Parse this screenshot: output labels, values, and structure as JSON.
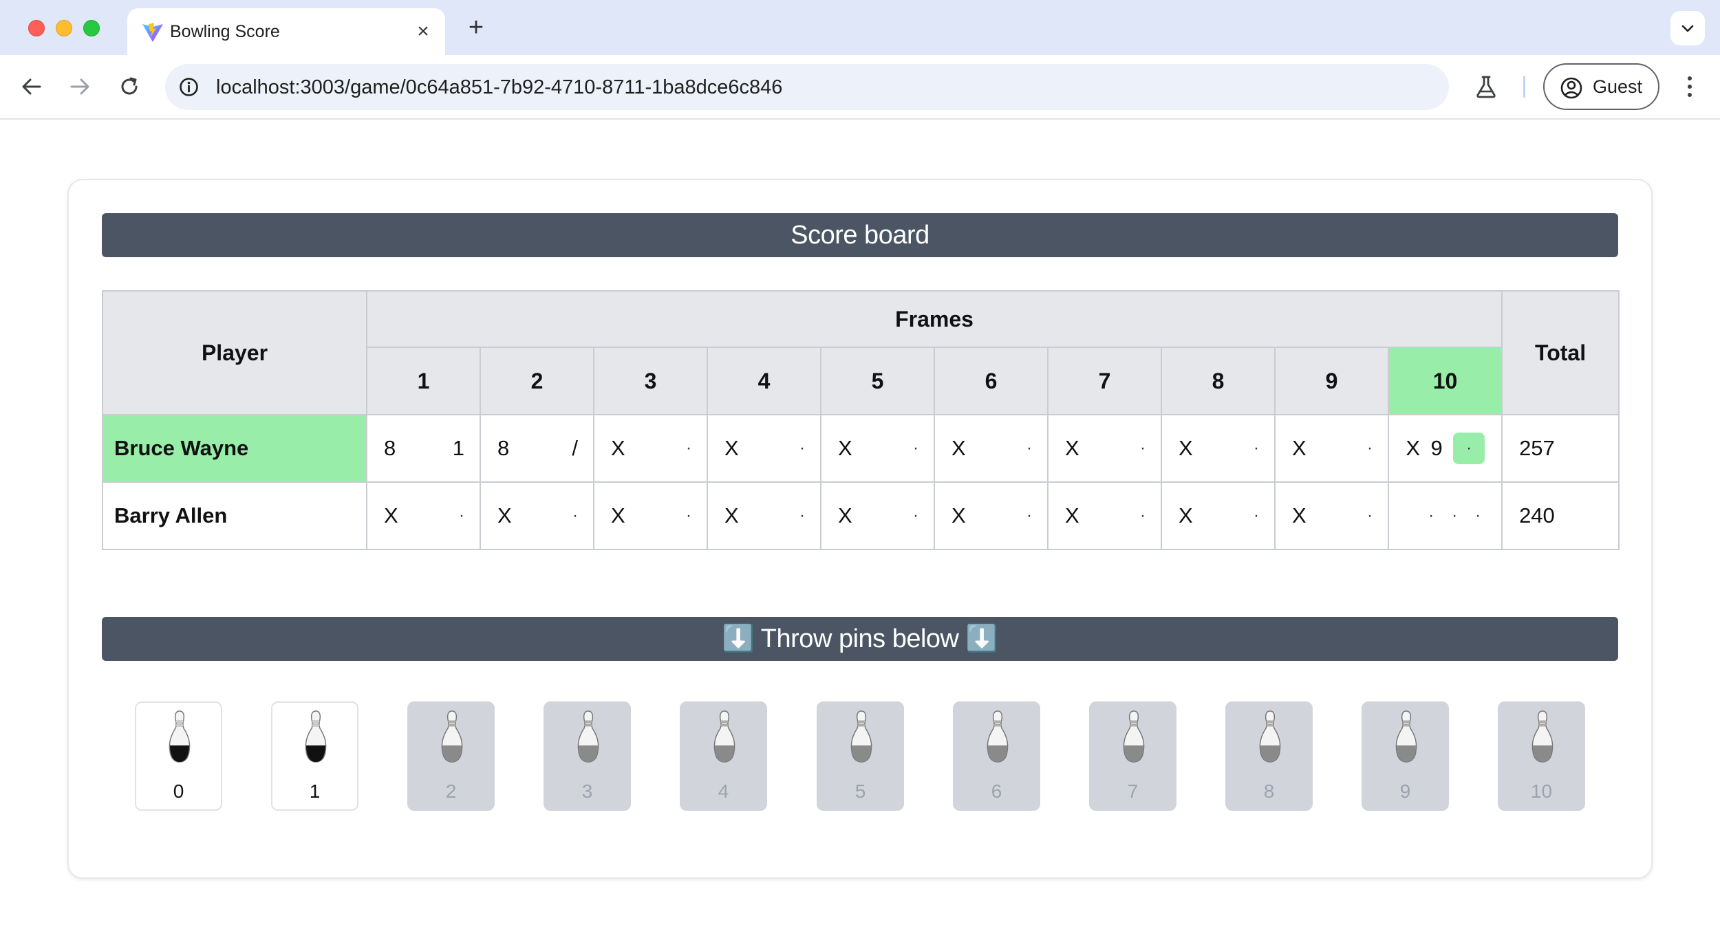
{
  "browser": {
    "tab_title": "Bowling Score",
    "tab_close": "×",
    "new_tab": "+",
    "url": "localhost:3003/game/0c64a851-7b92-4710-8711-1ba8dce6c846",
    "profile_label": "Guest"
  },
  "scoreboard": {
    "title": "Score board",
    "player_header": "Player",
    "frames_header": "Frames",
    "total_header": "Total",
    "frame_numbers": [
      "1",
      "2",
      "3",
      "4",
      "5",
      "6",
      "7",
      "8",
      "9",
      "10"
    ],
    "active_frame": "10",
    "players": [
      {
        "name": "Bruce Wayne",
        "active": true,
        "frames": [
          [
            "8",
            "1"
          ],
          [
            "8",
            "/"
          ],
          [
            "X",
            "·"
          ],
          [
            "X",
            "·"
          ],
          [
            "X",
            "·"
          ],
          [
            "X",
            "·"
          ],
          [
            "X",
            "·"
          ],
          [
            "X",
            "·"
          ],
          [
            "X",
            "·"
          ]
        ],
        "tenth": [
          "X",
          "9",
          "·"
        ],
        "current_roll": "3",
        "total": "257"
      },
      {
        "name": "Barry Allen",
        "active": false,
        "frames": [
          [
            "X",
            "·"
          ],
          [
            "X",
            "·"
          ],
          [
            "X",
            "·"
          ],
          [
            "X",
            "·"
          ],
          [
            "X",
            "·"
          ],
          [
            "X",
            "·"
          ],
          [
            "X",
            "·"
          ],
          [
            "X",
            "·"
          ],
          [
            "X",
            "·"
          ]
        ],
        "tenth": [
          "·",
          "·",
          "·"
        ],
        "total": "240"
      }
    ]
  },
  "throw": {
    "title": "⬇️ Throw pins below ⬇️",
    "pins": [
      {
        "label": "0",
        "enabled": true
      },
      {
        "label": "1",
        "enabled": true
      },
      {
        "label": "2",
        "enabled": false
      },
      {
        "label": "3",
        "enabled": false
      },
      {
        "label": "4",
        "enabled": false
      },
      {
        "label": "5",
        "enabled": false
      },
      {
        "label": "6",
        "enabled": false
      },
      {
        "label": "7",
        "enabled": false
      },
      {
        "label": "8",
        "enabled": false
      },
      {
        "label": "9",
        "enabled": false
      },
      {
        "label": "10",
        "enabled": false
      }
    ]
  },
  "colors": {
    "active_highlight": "#98eea9",
    "banner": "#4b5563",
    "disabled_pin": "#d1d5db"
  },
  "icons": {
    "pin": "bowling-pin-icon",
    "favicon": "vite-favicon-icon"
  }
}
